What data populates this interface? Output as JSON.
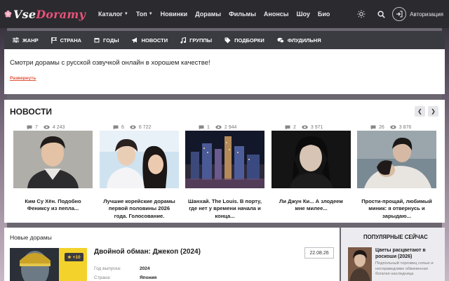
{
  "header": {
    "logo_prefix": "Vse",
    "logo_suffix": "Doramy",
    "nav": [
      {
        "label": "Каталог",
        "caret": true
      },
      {
        "label": "Топ",
        "caret": true
      },
      {
        "label": "Новинки",
        "caret": false
      },
      {
        "label": "Дорамы",
        "caret": false
      },
      {
        "label": "Фильмы",
        "caret": false
      },
      {
        "label": "Анонсы",
        "caret": false
      },
      {
        "label": "Шоу",
        "caret": false
      },
      {
        "label": "Био",
        "caret": false
      }
    ],
    "auth_label": "Авторизация"
  },
  "subnav": [
    {
      "label": "ЖАНР",
      "icon": "sliders-icon"
    },
    {
      "label": "СТРАНА",
      "icon": "flag-icon"
    },
    {
      "label": "ГОДЫ",
      "icon": "calendar-icon"
    },
    {
      "label": "НОВОСТИ",
      "icon": "megaphone-icon"
    },
    {
      "label": "ГРУППЫ",
      "icon": "music-icon"
    },
    {
      "label": "ПОДБОРКИ",
      "icon": "tag-icon"
    },
    {
      "label": "ФЛУДИЛЬНЯ",
      "icon": "chat-icon"
    }
  ],
  "intro": {
    "text": "Смотри дорамы с русской озвучкой онлайн в хорошем качестве!",
    "expand_link": "Развернуть"
  },
  "news": {
    "title": "НОВОСТИ",
    "items": [
      {
        "comments": "7",
        "views": "4 243",
        "caption": "Ким Су Хён. Подобно Фениксу из пепла..."
      },
      {
        "comments": "6",
        "views": "6 722",
        "caption": "Лучшие корейские дорамы первой половины 2026 года. Голосование."
      },
      {
        "comments": "1",
        "views": "2 944",
        "caption": "Шанхай. The Louis. В порту, где нет у времени начала и конца..."
      },
      {
        "comments": "2",
        "views": "3 971",
        "caption": "Ли Джун Ки... А злодеем мне милее..."
      },
      {
        "comments": "26",
        "views": "3 876",
        "caption": "Прости-прощай, любимый миник: я отвернусь и зарыдаю..."
      }
    ]
  },
  "new_dramas": {
    "title": "Новые дорамы",
    "badge": "★ +10",
    "name": "Двойной обман: Джекоп (2024)",
    "date": "22.08.26",
    "rows": [
      {
        "label": "Год выпуска:",
        "value": "2024"
      },
      {
        "label": "Страна:",
        "value": "Япония"
      }
    ]
  },
  "popular": {
    "title": "ПОПУЛЯРНЫЕ СЕЙЧАС",
    "name": "Цветы расцветают в роскоши (2026)",
    "desc": "Подпольный торговец солью и несправедливо обвиненная богатая наследница"
  },
  "colors": {
    "topbar": "#2b2b2f",
    "subnav": "#3a3b40",
    "accent_link": "#e0533a",
    "logo_accent": "#e8527a"
  }
}
